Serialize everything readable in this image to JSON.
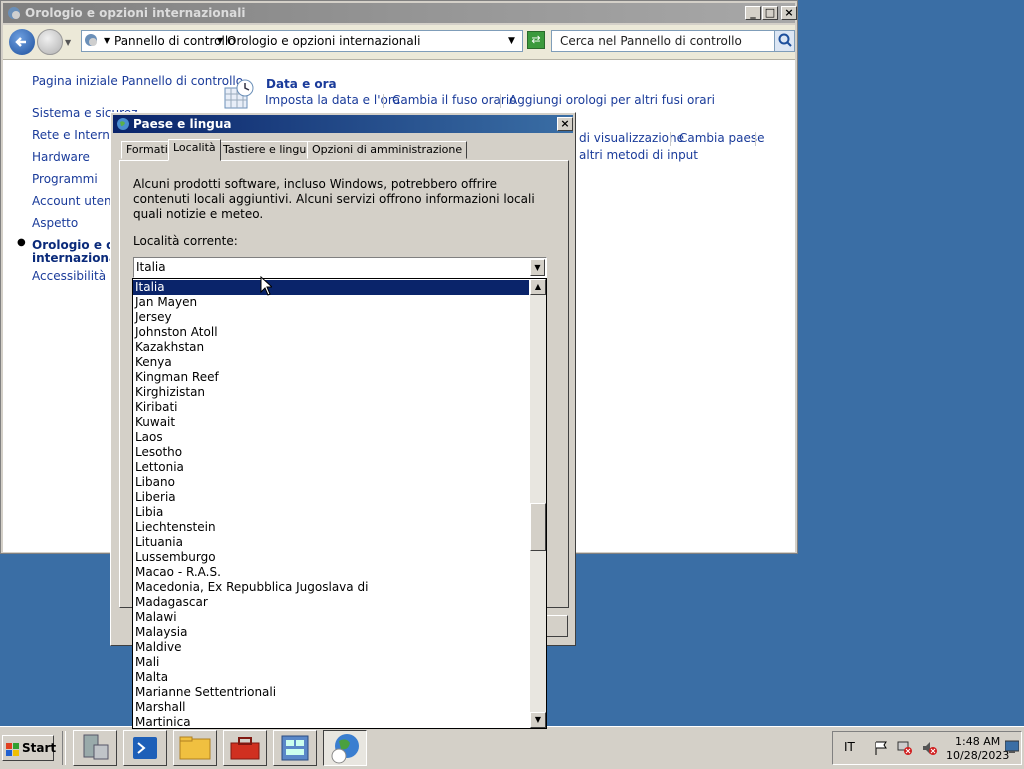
{
  "explorer": {
    "title": "Orologio e opzioni internazionali",
    "address": {
      "crumb1": "Pannello di controllo",
      "crumb2": "Orologio e opzioni internazionali"
    },
    "search_placeholder": "Cerca nel Pannello di controllo",
    "nav": {
      "home": "Pagina iniziale Pannello di controllo",
      "items": [
        "Sistema e sicurez",
        "Rete e Internet",
        "Hardware",
        "Programmi",
        "Account utente",
        "Aspetto"
      ],
      "current_line1": "Orologio e opz",
      "current_line2": "internazionali",
      "accessibility": "Accessibilità"
    },
    "content": {
      "heading": "Data e ora",
      "links": [
        "Imposta la data e l'ora",
        "Cambia il fuso orario",
        "Aggiungi orologi per altri fusi orari"
      ],
      "row2_links": [
        "di visualizzazione",
        "Cambia paese"
      ],
      "row3_link": "altri metodi di input"
    }
  },
  "dialog": {
    "title": "Paese e lingua",
    "tabs": [
      "Formati",
      "Località",
      "Tastiere e lingue",
      "Opzioni di amministrazione"
    ],
    "description": "Alcuni prodotti software, incluso Windows, potrebbero offrire contenuti locali aggiuntivi. Alcuni servizi offrono informazioni locali quali notizie e meteo.",
    "current_label": "Località corrente:",
    "current_value": "Italia",
    "options": [
      "Italia",
      "Jan Mayen",
      "Jersey",
      "Johnston Atoll",
      "Kazakhstan",
      "Kenya",
      "Kingman Reef",
      "Kirghizistan",
      "Kiribati",
      "Kuwait",
      "Laos",
      "Lesotho",
      "Lettonia",
      "Libano",
      "Liberia",
      "Libia",
      "Liechtenstein",
      "Lituania",
      "Lussemburgo",
      "Macao - R.A.S.",
      "Macedonia, Ex Repubblica Jugoslava di",
      "Madagascar",
      "Malawi",
      "Malaysia",
      "Maldive",
      "Mali",
      "Malta",
      "Marianne Settentrionali",
      "Marshall",
      "Martinica"
    ],
    "selected_option": "Italia"
  },
  "taskbar": {
    "start_label": "Start",
    "lang": "IT",
    "time": "1:48 AM",
    "date": "10/28/2023"
  },
  "colors": {
    "desktop": "#3a6ea5",
    "selection": "#0a246a",
    "link": "#1a3b9a"
  }
}
